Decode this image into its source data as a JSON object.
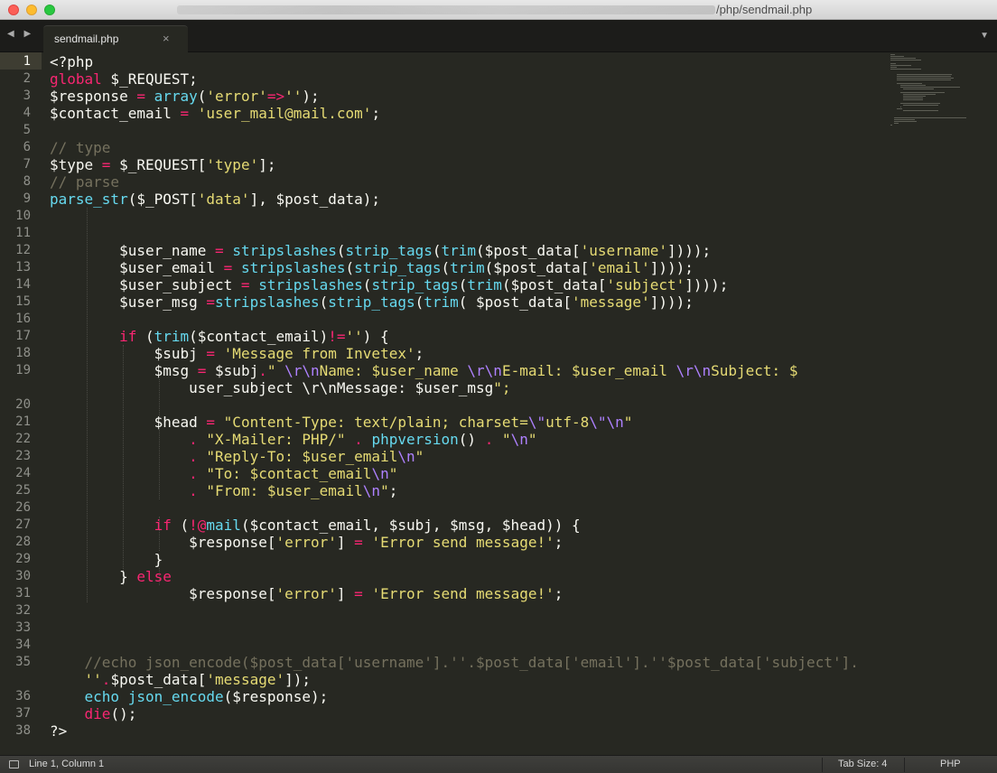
{
  "window": {
    "title_path": "/php/sendmail.php"
  },
  "tabs": [
    {
      "label": "sendmail.php",
      "close": "×"
    }
  ],
  "nav": {
    "arrows": "◀ ▶",
    "menu": "▼"
  },
  "editor": {
    "line_numbers": [
      "1",
      "2",
      "3",
      "4",
      "5",
      "6",
      "7",
      "8",
      "9",
      "10",
      "11",
      "12",
      "13",
      "14",
      "15",
      "16",
      "17",
      "18",
      "19",
      "",
      "20",
      "21",
      "22",
      "23",
      "24",
      "25",
      "26",
      "27",
      "28",
      "29",
      "30",
      "31",
      "32",
      "33",
      "34",
      "35",
      "",
      "36",
      "37",
      "38"
    ],
    "active_line": 1,
    "code_lines": [
      "<?php",
      "global $_REQUEST;",
      "$response = array('error'=>'');",
      "$contact_email = 'user_mail@mail.com';",
      "",
      "// type",
      "$type = $_REQUEST['type'];",
      "// parse",
      "parse_str($_POST['data'], $post_data);",
      "",
      "",
      "        $user_name = stripslashes(strip_tags(trim($post_data['username'])));",
      "        $user_email = stripslashes(strip_tags(trim($post_data['email'])));",
      "        $user_subject = stripslashes(strip_tags(trim($post_data['subject'])));",
      "        $user_msg =stripslashes(strip_tags(trim( $post_data['message'])));",
      "",
      "        if (trim($contact_email)!='') {",
      "            $subj = 'Message from Invetex';",
      "            $msg = $subj.\" \\r\\nName: $user_name \\r\\nE-mail: $user_email \\r\\nSubject: $",
      "                user_subject \\r\\nMessage: $user_msg\";",
      "",
      "            $head = \"Content-Type: text/plain; charset=\\\"utf-8\\\"\\n\"",
      "                . \"X-Mailer: PHP/\" . phpversion() . \"\\n\"",
      "                . \"Reply-To: $user_email\\n\"",
      "                . \"To: $contact_email\\n\"",
      "                . \"From: $user_email\\n\";",
      "",
      "            if (!@mail($contact_email, $subj, $msg, $head)) {",
      "                $response['error'] = 'Error send message!';",
      "            }",
      "        } else",
      "                $response['error'] = 'Error send message!';",
      "",
      "",
      "",
      "    //echo json_encode($post_data['username'].''.$post_data['email'].''$post_data['subject'].",
      "    ''.$post_data['message']);",
      "    echo json_encode($response);",
      "    die();",
      "?>"
    ]
  },
  "status": {
    "position": "Line 1, Column 1",
    "tab_size": "Tab Size: 4",
    "syntax": "PHP"
  },
  "colors": {
    "background": "#272822",
    "keyword": "#f92672",
    "function": "#66d9ef",
    "string": "#e6db74",
    "comment": "#75715e",
    "constant": "#ae81ff"
  }
}
